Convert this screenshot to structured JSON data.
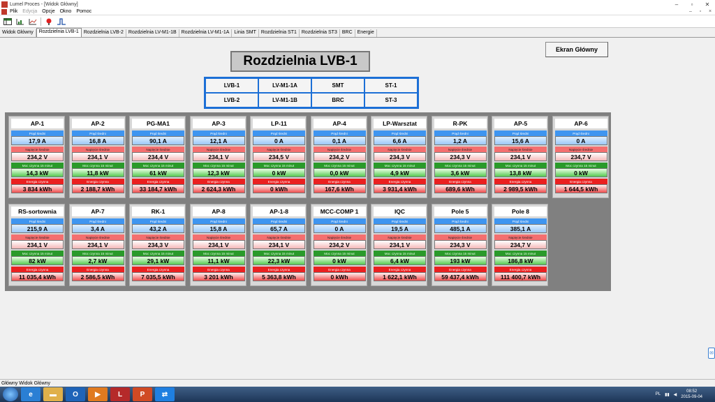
{
  "window": {
    "title": "Lumel Proces - [Widok Główny]",
    "min_icon": "minimize-icon",
    "max_icon": "maximize-icon",
    "close_icon": "close-icon"
  },
  "menu": {
    "items": [
      {
        "label": "Plik",
        "enabled": true
      },
      {
        "label": "Edycja",
        "enabled": false
      },
      {
        "label": "Opcje",
        "enabled": true
      },
      {
        "label": "Okno",
        "enabled": true
      },
      {
        "label": "Pomoc",
        "enabled": true
      }
    ],
    "right_glyphs": [
      "–",
      "▫",
      "×"
    ]
  },
  "toolbar": {
    "icons": [
      "table-icon",
      "chart-icon",
      "trend-icon",
      "alarm-icon",
      "signal-icon"
    ]
  },
  "tabs": [
    {
      "label": "Widok Główny",
      "active": false
    },
    {
      "label": "Rozdzielnia LVB-1",
      "active": true
    },
    {
      "label": "Rozdzielnia LVB-2",
      "active": false
    },
    {
      "label": "Rozdzielnia LV-M1-1B",
      "active": false
    },
    {
      "label": "Rozdzielnia LV-M1-1A",
      "active": false
    },
    {
      "label": "Linia SMT",
      "active": false
    },
    {
      "label": "Rozdzielnia ST1",
      "active": false
    },
    {
      "label": "Rozdzielnia ST3",
      "active": false
    },
    {
      "label": "BRC",
      "active": false
    },
    {
      "label": "Energie",
      "active": false
    }
  ],
  "page": {
    "title": "Rozdzielnia LVB-1",
    "home_button": "Ekran Główny",
    "nav": [
      "LVB-1",
      "LV-M1-1A",
      "SMT",
      "ST-1",
      "LVB-2",
      "LV-M1-1B",
      "BRC",
      "ST-3"
    ]
  },
  "labels": {
    "current": "Prąd średni",
    "voltage": "Napięcie średnie",
    "power": "Moc czynna 15 minut",
    "energy": "Energia czynna"
  },
  "cards": [
    {
      "name": "AP-1",
      "current": "17,9 A",
      "voltage": "234,2 V",
      "power": "14,3 kW",
      "energy": "3 834 kWh"
    },
    {
      "name": "AP-2",
      "current": "16,8 A",
      "voltage": "234,1 V",
      "power": "11,8 kW",
      "energy": "2 188,7 kWh"
    },
    {
      "name": "PG-MA1",
      "current": "90,1 A",
      "voltage": "234,4 V",
      "power": "61 kW",
      "energy": "33 184,7 kWh"
    },
    {
      "name": "AP-3",
      "current": "12,1 A",
      "voltage": "234,1 V",
      "power": "12,3 kW",
      "energy": "2 624,3 kWh"
    },
    {
      "name": "LP-11",
      "current": "0 A",
      "voltage": "234,5 V",
      "power": "0 kW",
      "energy": "0 kWh"
    },
    {
      "name": "AP-4",
      "current": "0,1 A",
      "voltage": "234,2 V",
      "power": "0,0 kW",
      "energy": "167,6 kWh"
    },
    {
      "name": "LP-Warsztat",
      "current": "6,6 A",
      "voltage": "234,3 V",
      "power": "4,9 kW",
      "energy": "3 931,4 kWh"
    },
    {
      "name": "R-PK",
      "current": "1,2 A",
      "voltage": "234,3 V",
      "power": "3,6 kW",
      "energy": "689,6 kWh"
    },
    {
      "name": "AP-5",
      "current": "15,6 A",
      "voltage": "234,1 V",
      "power": "13,8 kW",
      "energy": "2 989,5 kWh"
    },
    {
      "name": "AP-6",
      "current": "0 A",
      "voltage": "234,7 V",
      "power": "0 kW",
      "energy": "1 644,5 kWh"
    },
    {
      "name": "RS-sortownia",
      "current": "215,9 A",
      "voltage": "234,1 V",
      "power": "82 kW",
      "energy": "11 035,4 kWh"
    },
    {
      "name": "AP-7",
      "current": "3,4 A",
      "voltage": "234,1 V",
      "power": "2,7 kW",
      "energy": "2 586,5 kWh"
    },
    {
      "name": "RK-1",
      "current": "43,2 A",
      "voltage": "234,3 V",
      "power": "29,1 kW",
      "energy": "7 035,5 kWh"
    },
    {
      "name": "AP-8",
      "current": "15,8 A",
      "voltage": "234,1 V",
      "power": "11,1 kW",
      "energy": "3 201 kWh"
    },
    {
      "name": "AP-1-8",
      "current": "65,7 A",
      "voltage": "234,1 V",
      "power": "22,3 kW",
      "energy": "5 363,8 kWh"
    },
    {
      "name": "MCC-COMP 1",
      "current": "0 A",
      "voltage": "234,2 V",
      "power": "0 kW",
      "energy": "0 kWh"
    },
    {
      "name": "IQC",
      "current": "19,5 A",
      "voltage": "234,1 V",
      "power": "6,4 kW",
      "energy": "1 622,1 kWh"
    },
    {
      "name": "Pole 5",
      "current": "485,1 A",
      "voltage": "234,3 V",
      "power": "193 kW",
      "energy": "59 437,4 kWh"
    },
    {
      "name": "Pole 8",
      "current": "385,1 A",
      "voltage": "234,7 V",
      "power": "186,8 kW",
      "energy": "111 400,7 kWh"
    }
  ],
  "status": {
    "text": "Główny Widok Główny"
  },
  "taskbar": {
    "apps": [
      {
        "icon": "ie-icon",
        "glyph": "e",
        "color": "#2a7fd4"
      },
      {
        "icon": "folder-icon",
        "glyph": "▬",
        "color": "#e0b04a"
      },
      {
        "icon": "outlook-icon",
        "glyph": "O",
        "color": "#1f64b8"
      },
      {
        "icon": "media-player-icon",
        "glyph": "▶",
        "color": "#e07a1f"
      },
      {
        "icon": "lumel-app-icon",
        "glyph": "L",
        "color": "#b52a2a"
      },
      {
        "icon": "powerpoint-icon",
        "glyph": "P",
        "color": "#d04a24"
      },
      {
        "icon": "teamviewer-icon",
        "glyph": "⇄",
        "color": "#1f7fe0"
      }
    ],
    "lang": "PL",
    "time": "08:52",
    "date": "2015-09-04"
  },
  "side_widget": {
    "icon": "chat-icon"
  }
}
